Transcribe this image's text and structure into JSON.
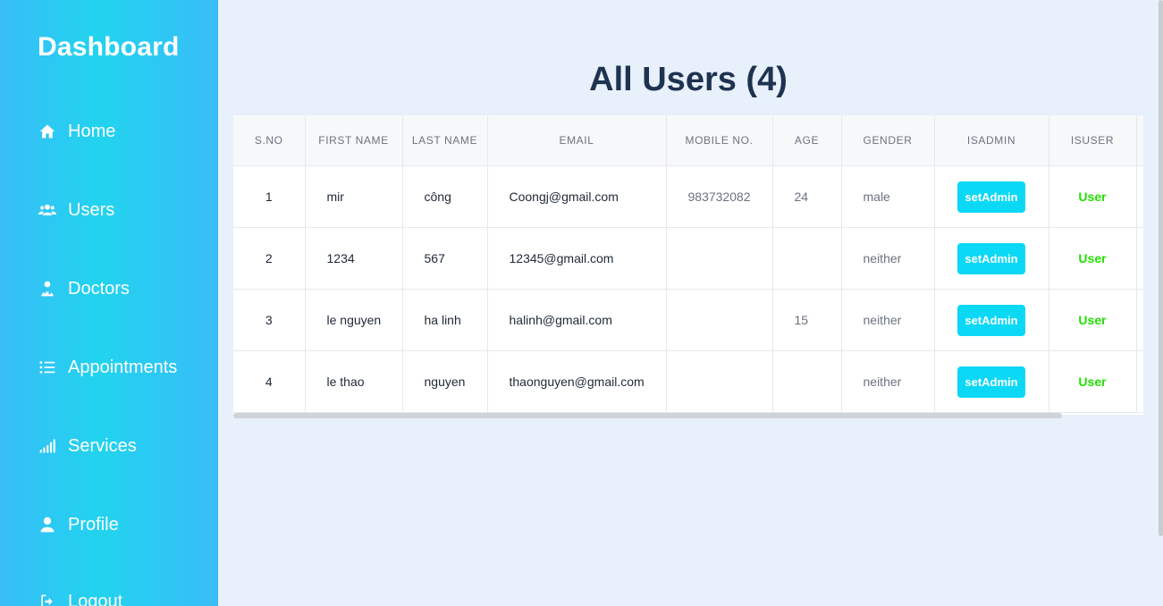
{
  "sidebar": {
    "brand": "Dashboard",
    "items": [
      {
        "label": "Home",
        "icon": "home-icon"
      },
      {
        "label": "Users",
        "icon": "users-icon"
      },
      {
        "label": "Doctors",
        "icon": "doctor-icon"
      },
      {
        "label": "Appointments",
        "icon": "list-icon"
      },
      {
        "label": "Services",
        "icon": "signal-icon"
      },
      {
        "label": "Profile",
        "icon": "user-icon"
      },
      {
        "label": "Logout",
        "icon": "logout-icon"
      }
    ]
  },
  "main": {
    "title": "All Users (4)",
    "table": {
      "headers": [
        "S.NO",
        "FIRST NAME",
        "LAST NAME",
        "EMAIL",
        "MOBILE NO.",
        "AGE",
        "GENDER",
        "ISADMIN",
        "ISUSER"
      ],
      "rows": [
        {
          "sno": "1",
          "first": "mir",
          "last": "công",
          "email": "Coongj@gmail.com",
          "mobile": "983732082",
          "age": "24",
          "gender": "male",
          "admin_btn": "setAdmin",
          "role": "User"
        },
        {
          "sno": "2",
          "first": "1234",
          "last": "567",
          "email": "12345@gmail.com",
          "mobile": "",
          "age": "",
          "gender": "neither",
          "admin_btn": "setAdmin",
          "role": "User"
        },
        {
          "sno": "3",
          "first": "le nguyen",
          "last": "ha linh",
          "email": "halinh@gmail.com",
          "mobile": "",
          "age": "15",
          "gender": "neither",
          "admin_btn": "setAdmin",
          "role": "User"
        },
        {
          "sno": "4",
          "first": "le thao",
          "last": "nguyen",
          "email": "thaonguyen@gmail.com",
          "mobile": "",
          "age": "",
          "gender": "neither",
          "admin_btn": "setAdmin",
          "role": "User"
        }
      ]
    }
  },
  "colors": {
    "sidebar": "#38bdf8",
    "title": "#1e3350",
    "admin_button": "#0bd8f5",
    "user_role": "#22e000",
    "page_bg": "#e8f0fb"
  }
}
